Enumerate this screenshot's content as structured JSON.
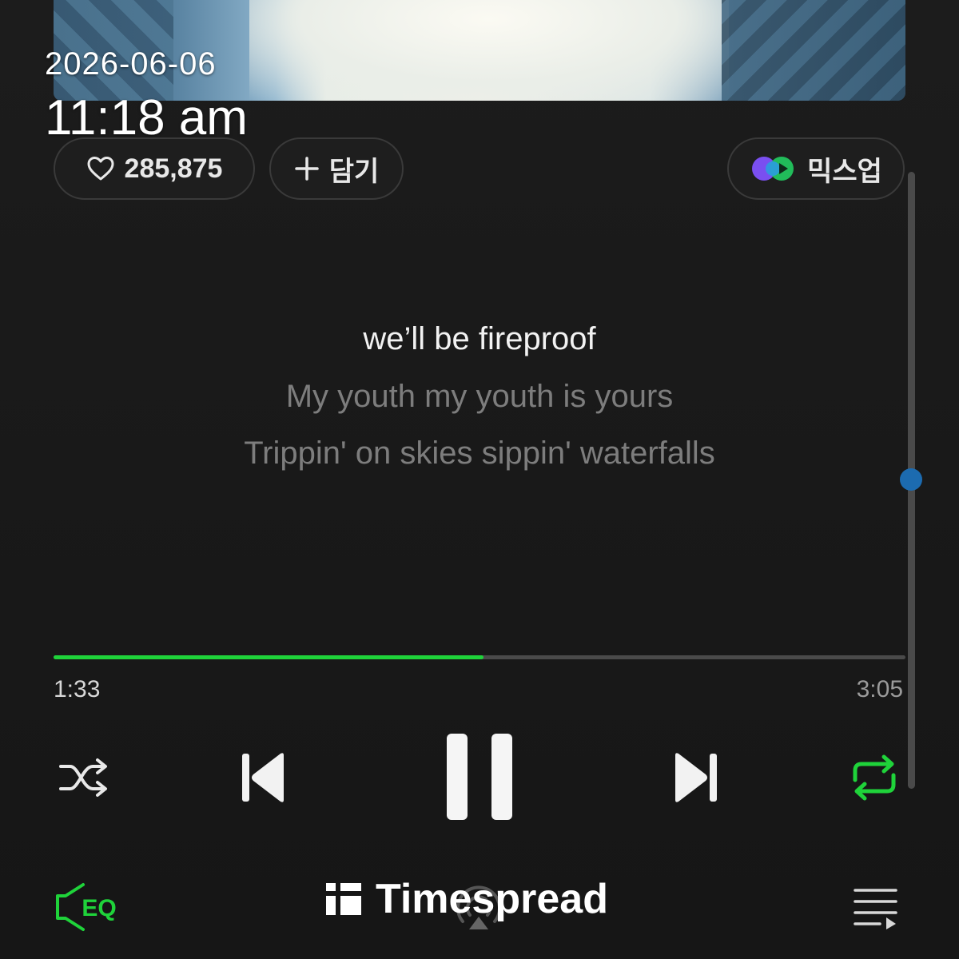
{
  "timestamp": {
    "date": "2026-06-06",
    "time": "11:18 am"
  },
  "actions": {
    "like_count": "285,875",
    "add_label": "담기",
    "mixup_label": "믹스업"
  },
  "lyrics": {
    "current": "we’ll be fireproof",
    "next": "My youth my youth is yours",
    "next2": "Trippin' on skies sippin' waterfalls"
  },
  "playback": {
    "elapsed": "1:33",
    "total": "3:05",
    "progress_fraction": 0.505
  },
  "controls": {
    "shuffle_icon": "shuffle-icon",
    "previous_icon": "previous-icon",
    "pause_icon": "pause-icon",
    "next_icon": "next-icon",
    "repeat_icon": "repeat-icon",
    "eq_label": "EQ",
    "cast_icon": "cast-icon",
    "queue_icon": "queue-icon"
  },
  "watermark": {
    "brand": "Timespread"
  },
  "colors": {
    "accent_green": "#1fd33a",
    "background": "#1a1a1a",
    "scroll_thumb": "#1c6bb0"
  }
}
